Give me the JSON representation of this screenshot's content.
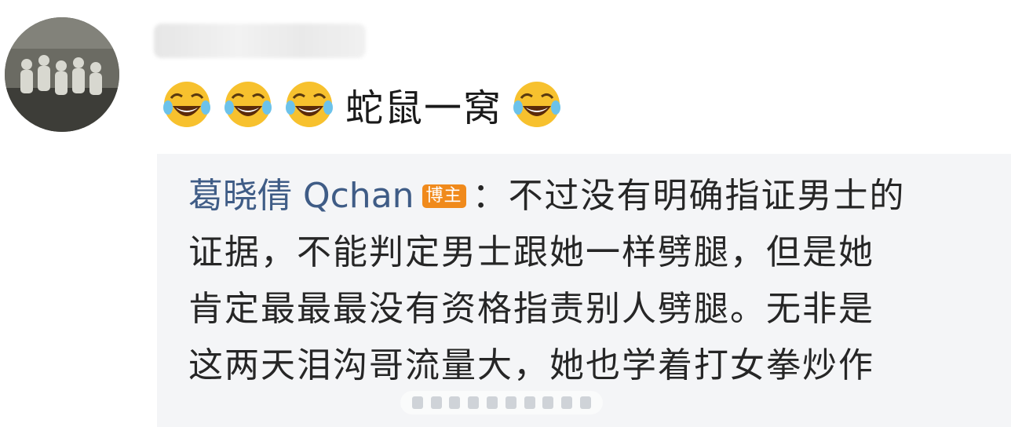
{
  "comment": {
    "emojis_before": [
      "laughing-tears-emoji",
      "laughing-tears-emoji",
      "laughing-tears-emoji"
    ],
    "text": "蛇鼠一窝",
    "emojis_after": [
      "laughing-tears-emoji"
    ]
  },
  "reply": {
    "author": "葛晓倩 Qchan",
    "badge": "博主",
    "separator": "：",
    "lines": [
      "不过没有明确指证男士的",
      "证据，不能判定男士跟她一样劈腿，但是她",
      "肯定最最最没有资格指责别人劈腿。无非是",
      "这两天泪沟哥流量大，她也学着打女拳炒作"
    ]
  },
  "colors": {
    "author": "#3f5c86",
    "badge_bg": "#f08a1c",
    "reply_bg": "#f4f5f7",
    "text": "#262626"
  }
}
